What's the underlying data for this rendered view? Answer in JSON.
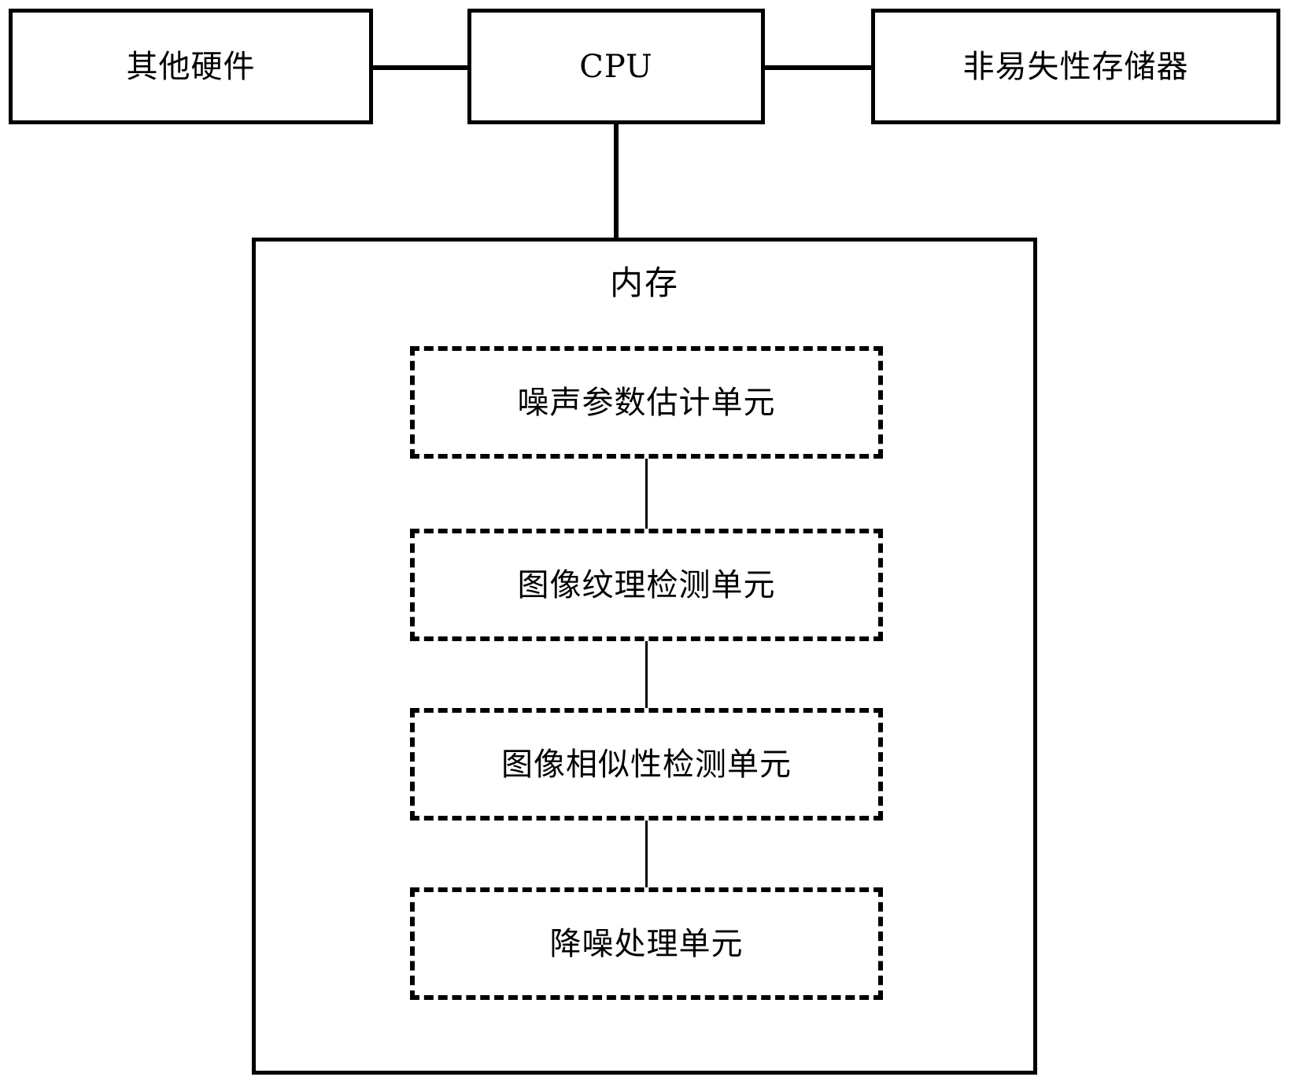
{
  "diagram": {
    "type": "block-diagram",
    "language": "zh-CN",
    "stroke_color": "#000000",
    "background_color": "#ffffff",
    "top_row": [
      {
        "id": "other-hardware",
        "label": "其他硬件"
      },
      {
        "id": "cpu",
        "label": "CPU"
      },
      {
        "id": "nonvolatile-storage",
        "label": "非易失性存储器"
      }
    ],
    "memory": {
      "title": "内存",
      "units": [
        {
          "id": "noise-parameter-estimation-unit",
          "label": "噪声参数估计单元"
        },
        {
          "id": "image-texture-detection-unit",
          "label": "图像纹理检测单元"
        },
        {
          "id": "image-similarity-detection-unit",
          "label": "图像相似性检测单元"
        },
        {
          "id": "noise-reduction-processing-unit",
          "label": "降噪处理单元"
        }
      ]
    },
    "connections": [
      {
        "from": "other-hardware",
        "to": "cpu",
        "style": "solid"
      },
      {
        "from": "cpu",
        "to": "nonvolatile-storage",
        "style": "solid"
      },
      {
        "from": "cpu",
        "to": "memory",
        "style": "solid"
      },
      {
        "from": "noise-parameter-estimation-unit",
        "to": "image-texture-detection-unit",
        "style": "thin"
      },
      {
        "from": "image-texture-detection-unit",
        "to": "image-similarity-detection-unit",
        "style": "thin"
      },
      {
        "from": "image-similarity-detection-unit",
        "to": "noise-reduction-processing-unit",
        "style": "thin"
      }
    ]
  }
}
